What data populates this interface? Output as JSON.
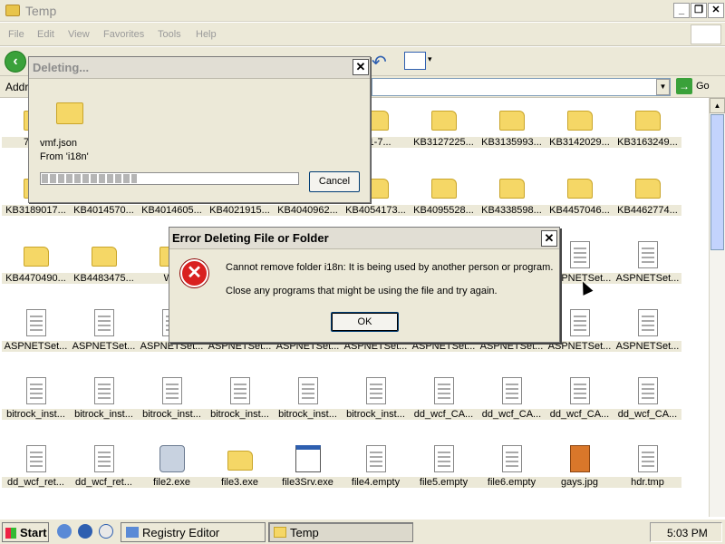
{
  "window": {
    "title": "Temp",
    "min": "_",
    "max": "❐",
    "close": "✕"
  },
  "menu": [
    "File",
    "Edit",
    "View",
    "Favorites",
    "Tools",
    "Help"
  ],
  "address": {
    "label": "Address",
    "go": "Go"
  },
  "files": [
    {
      "name": "7zEC",
      "type": "folder"
    },
    {
      "name": "",
      "type": "folder"
    },
    {
      "name": "",
      "type": "folder"
    },
    {
      "name": "",
      "type": "folder"
    },
    {
      "name": "",
      "type": "folder"
    },
    {
      "name": "7f1-7...",
      "type": "folder"
    },
    {
      "name": "KB3127225...",
      "type": "folder"
    },
    {
      "name": "KB3135993...",
      "type": "folder"
    },
    {
      "name": "KB3142029...",
      "type": "folder"
    },
    {
      "name": "KB3163249...",
      "type": "folder"
    },
    {
      "name": "KB3189017...",
      "type": "folder"
    },
    {
      "name": "KB4014570...",
      "type": "folder"
    },
    {
      "name": "KB4014605...",
      "type": "folder"
    },
    {
      "name": "KB4021915...",
      "type": "folder"
    },
    {
      "name": "KB4040962...",
      "type": "folder"
    },
    {
      "name": "KB4054173...",
      "type": "folder"
    },
    {
      "name": "KB4095528...",
      "type": "folder"
    },
    {
      "name": "KB4338598...",
      "type": "folder"
    },
    {
      "name": "KB4457046...",
      "type": "folder"
    },
    {
      "name": "KB4462774...",
      "type": "folder"
    },
    {
      "name": "KB4470490...",
      "type": "folder"
    },
    {
      "name": "KB4483475...",
      "type": "folder"
    },
    {
      "name": "WP",
      "type": "folder"
    },
    {
      "name": "",
      "type": "doc"
    },
    {
      "name": "",
      "type": "doc"
    },
    {
      "name": "",
      "type": "doc"
    },
    {
      "name": "",
      "type": "doc"
    },
    {
      "name": "",
      "type": "doc"
    },
    {
      "name": "ASPNETSet...",
      "type": "doc"
    },
    {
      "name": "ASPNETSet...",
      "type": "doc"
    },
    {
      "name": "ASPNETSet...",
      "type": "doc"
    },
    {
      "name": "ASPNETSet...",
      "type": "doc"
    },
    {
      "name": "ASPNETSet...",
      "type": "doc"
    },
    {
      "name": "ASPNETSet...",
      "type": "doc"
    },
    {
      "name": "ASPNETSet...",
      "type": "doc"
    },
    {
      "name": "ASPNETSet...",
      "type": "doc"
    },
    {
      "name": "ASPNETSet...",
      "type": "doc"
    },
    {
      "name": "ASPNETSet...",
      "type": "doc"
    },
    {
      "name": "ASPNETSet...",
      "type": "doc"
    },
    {
      "name": "ASPNETSet...",
      "type": "doc"
    },
    {
      "name": "bitrock_inst...",
      "type": "doc"
    },
    {
      "name": "bitrock_inst...",
      "type": "doc"
    },
    {
      "name": "bitrock_inst...",
      "type": "doc"
    },
    {
      "name": "bitrock_inst...",
      "type": "doc"
    },
    {
      "name": "bitrock_inst...",
      "type": "doc"
    },
    {
      "name": "bitrock_inst...",
      "type": "doc"
    },
    {
      "name": "dd_wcf_CA...",
      "type": "doc"
    },
    {
      "name": "dd_wcf_CA...",
      "type": "doc"
    },
    {
      "name": "dd_wcf_CA...",
      "type": "doc"
    },
    {
      "name": "dd_wcf_CA...",
      "type": "doc"
    },
    {
      "name": "dd_wcf_ret...",
      "type": "doc"
    },
    {
      "name": "dd_wcf_ret...",
      "type": "doc"
    },
    {
      "name": "file2.exe",
      "type": "gear"
    },
    {
      "name": "file3.exe",
      "type": "folder"
    },
    {
      "name": "file3Srv.exe",
      "type": "exe"
    },
    {
      "name": "file4.empty",
      "type": "doc"
    },
    {
      "name": "file5.empty",
      "type": "doc"
    },
    {
      "name": "file6.empty",
      "type": "doc"
    },
    {
      "name": "gays.jpg",
      "type": "img"
    },
    {
      "name": "hdr.tmp",
      "type": "doc"
    }
  ],
  "deleting_dialog": {
    "title": "Deleting...",
    "file": "vmf.json",
    "from": "From 'i18n'",
    "progress": 0.37,
    "cancel": "Cancel",
    "close": "✕"
  },
  "error_dialog": {
    "title": "Error Deleting File or Folder",
    "message": "Cannot remove folder i18n: It is being used by another person or program.",
    "hint": "Close any programs that might be using the file and try again.",
    "ok": "OK",
    "close": "✕",
    "icon": "✕"
  },
  "taskbar": {
    "start": "Start",
    "tasks": [
      "Registry Editor",
      "Temp"
    ],
    "clock": "5:03 PM"
  }
}
